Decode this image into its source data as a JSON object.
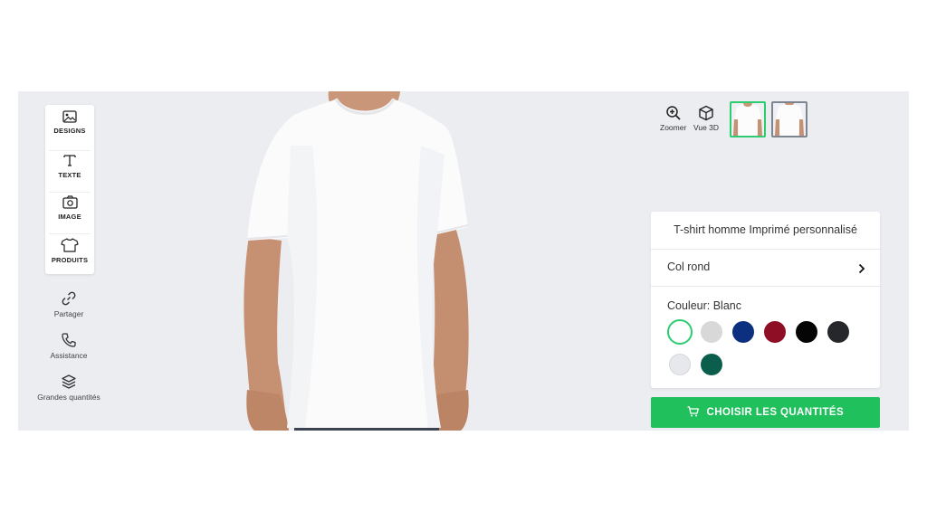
{
  "toolbar": {
    "items": [
      {
        "label": "DESIGNS",
        "icon": "image-icon"
      },
      {
        "label": "TEXTE",
        "icon": "text-icon"
      },
      {
        "label": "IMAGE",
        "icon": "camera-icon"
      },
      {
        "label": "PRODUITS",
        "icon": "tshirt-icon"
      }
    ]
  },
  "side_links": [
    {
      "label": "Partager",
      "icon": "link-icon"
    },
    {
      "label": "Assistance",
      "icon": "phone-icon"
    },
    {
      "label": "Grandes quantités",
      "icon": "layers-icon"
    }
  ],
  "view": {
    "zoom_label": "Zoomer",
    "view3d_label": "Vue 3D",
    "thumbnails": [
      "front",
      "back"
    ],
    "active_thumbnail": "front"
  },
  "product": {
    "title": "T-shirt homme Imprimé personnalisé",
    "style_label": "Col rond",
    "color_label": "Couleur: Blanc",
    "colors": [
      {
        "name": "Blanc",
        "hex": "#ffffff",
        "selected": true
      },
      {
        "name": "Gris clair",
        "hex": "#d8d8d8",
        "selected": false
      },
      {
        "name": "Bleu marine",
        "hex": "#0d2f7f",
        "selected": false
      },
      {
        "name": "Bordeaux",
        "hex": "#8e0e25",
        "selected": false
      },
      {
        "name": "Noir",
        "hex": "#050505",
        "selected": false
      },
      {
        "name": "Anthracite",
        "hex": "#25272b",
        "selected": false
      },
      {
        "name": "Gris perle",
        "hex": "#e7e8ec",
        "selected": false
      },
      {
        "name": "Vert bouteille",
        "hex": "#0b5e4b",
        "selected": false
      }
    ]
  },
  "cta": {
    "label": "CHOISIR LES QUANTITÉS",
    "icon": "cart-icon"
  },
  "colors": {
    "accent": "#20c05c",
    "selected_ring": "#2ecc71",
    "stage_bg": "#ecedf1"
  }
}
